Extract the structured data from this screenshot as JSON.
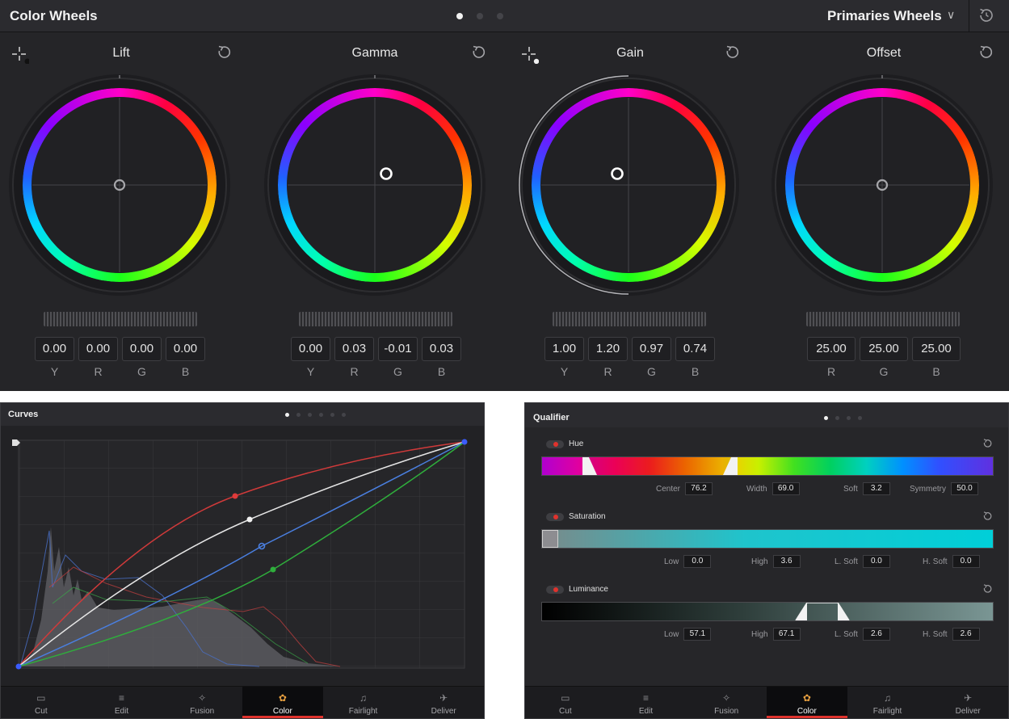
{
  "color_wheels": {
    "title": "Color Wheels",
    "mode": "Primaries Wheels",
    "page_dots": 3,
    "active_page": 0,
    "wheels": [
      {
        "name": "Lift",
        "values": [
          "0.00",
          "0.00",
          "0.00",
          "0.00"
        ],
        "labels": [
          "Y",
          "R",
          "G",
          "B"
        ]
      },
      {
        "name": "Gamma",
        "values": [
          "0.00",
          "0.03",
          "-0.01",
          "0.03"
        ],
        "labels": [
          "Y",
          "R",
          "G",
          "B"
        ]
      },
      {
        "name": "Gain",
        "values": [
          "1.00",
          "1.20",
          "0.97",
          "0.74"
        ],
        "labels": [
          "Y",
          "R",
          "G",
          "B"
        ]
      },
      {
        "name": "Offset",
        "values": [
          "25.00",
          "25.00",
          "25.00"
        ],
        "labels": [
          "R",
          "G",
          "B"
        ]
      }
    ]
  },
  "curves": {
    "title": "Curves",
    "page_dots": 6,
    "active_page": 0
  },
  "qualifier": {
    "title": "Qualifier",
    "page_dots": 4,
    "active_page": 0,
    "hue": {
      "label": "Hue",
      "fields": [
        {
          "label": "Center",
          "value": "76.2"
        },
        {
          "label": "Width",
          "value": "69.0"
        },
        {
          "label": "Soft",
          "value": "3.2"
        },
        {
          "label": "Symmetry",
          "value": "50.0"
        }
      ]
    },
    "saturation": {
      "label": "Saturation",
      "fields": [
        {
          "label": "Low",
          "value": "0.0"
        },
        {
          "label": "High",
          "value": "3.6"
        },
        {
          "label": "L. Soft",
          "value": "0.0"
        },
        {
          "label": "H. Soft",
          "value": "0.0"
        }
      ]
    },
    "luminance": {
      "label": "Luminance",
      "fields": [
        {
          "label": "Low",
          "value": "57.1"
        },
        {
          "label": "High",
          "value": "67.1"
        },
        {
          "label": "L. Soft",
          "value": "2.6"
        },
        {
          "label": "H. Soft",
          "value": "2.6"
        }
      ]
    }
  },
  "page_nav": {
    "items": [
      {
        "label": "Cut",
        "icon": "cut-icon"
      },
      {
        "label": "Edit",
        "icon": "edit-icon"
      },
      {
        "label": "Fusion",
        "icon": "fusion-icon"
      },
      {
        "label": "Color",
        "icon": "color-icon"
      },
      {
        "label": "Fairlight",
        "icon": "fairlight-icon"
      },
      {
        "label": "Deliver",
        "icon": "deliver-icon"
      }
    ],
    "active": "Color"
  },
  "colors": {
    "accent_red": "#e0322d",
    "curve_red": "#d03a3a",
    "curve_green": "#2fae3c",
    "curve_blue": "#4a7fe0",
    "curve_luma": "#e6e6e6"
  }
}
